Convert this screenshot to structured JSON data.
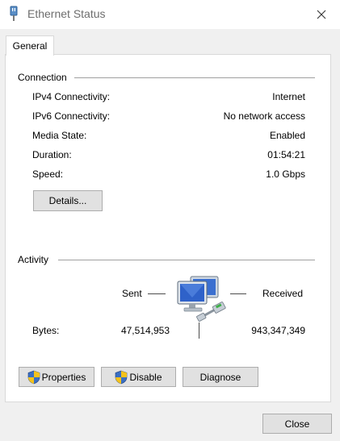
{
  "window": {
    "title": "Ethernet Status",
    "title_icon": "ethernet-adapter-icon",
    "close_icon": "close-icon"
  },
  "tabs": [
    {
      "label": "General",
      "selected": true
    }
  ],
  "connection": {
    "group_label": "Connection",
    "rows": [
      {
        "label": "IPv4 Connectivity:",
        "value": "Internet"
      },
      {
        "label": "IPv6 Connectivity:",
        "value": "No network access"
      },
      {
        "label": "Media State:",
        "value": "Enabled"
      },
      {
        "label": "Duration:",
        "value": "01:54:21"
      },
      {
        "label": "Speed:",
        "value": "1.0 Gbps"
      }
    ],
    "details_button": "Details..."
  },
  "activity": {
    "group_label": "Activity",
    "sent_label": "Sent",
    "received_label": "Received",
    "network_icon": "network-computers-icon",
    "bytes_label": "Bytes:",
    "bytes_sent": "47,514,953",
    "bytes_received": "943,347,349"
  },
  "buttons": {
    "properties": "Properties",
    "disable": "Disable",
    "diagnose": "Diagnose",
    "close": "Close",
    "shield_icon": "uac-shield-icon"
  }
}
